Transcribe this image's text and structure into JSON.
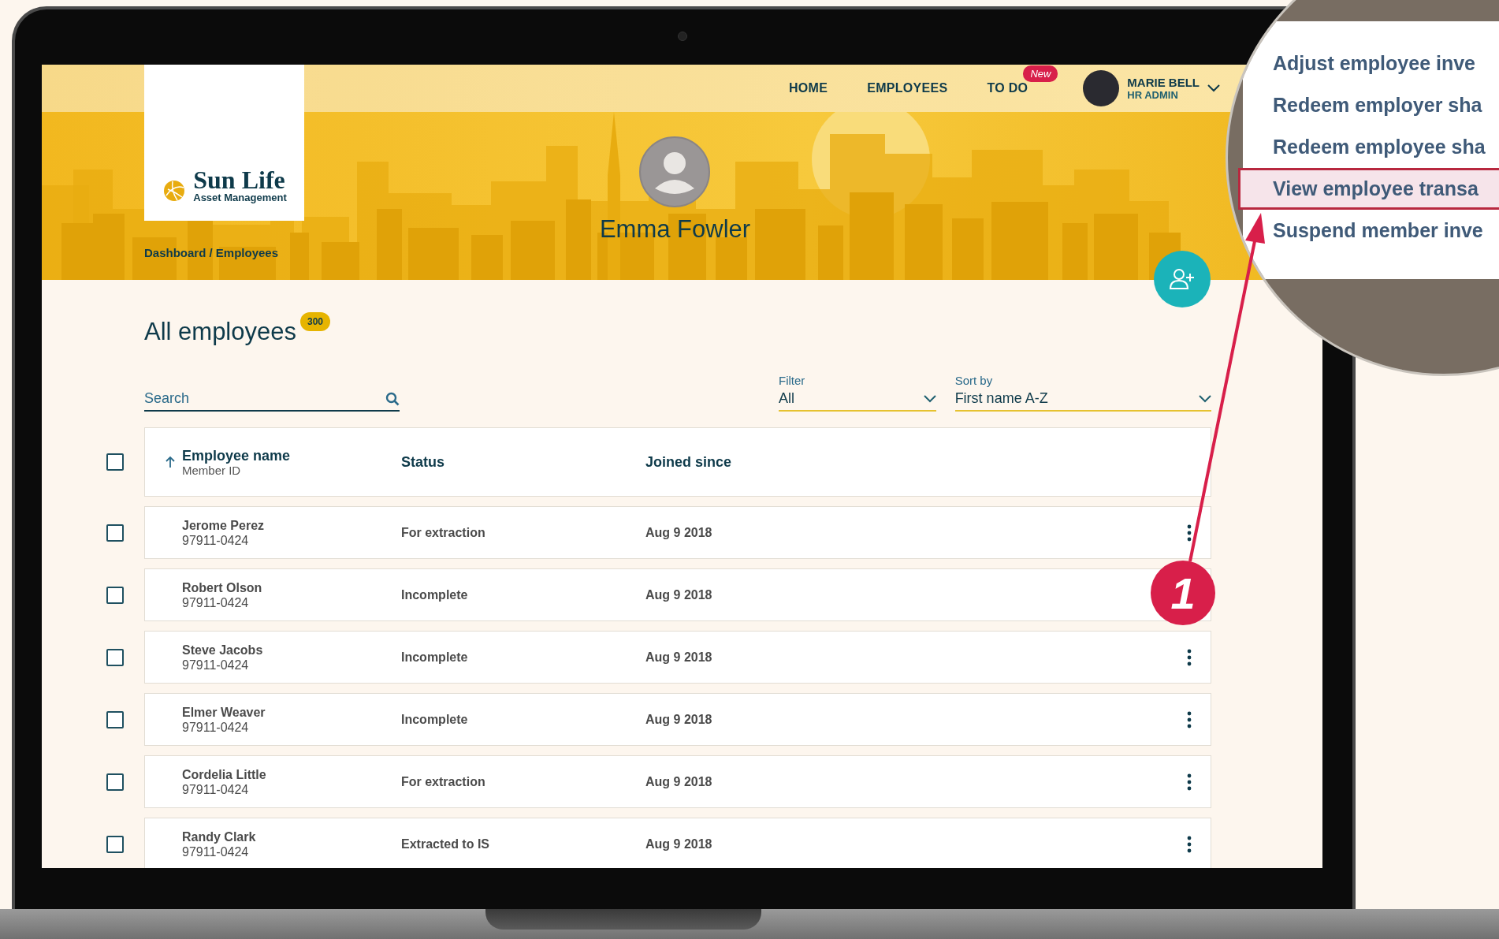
{
  "nav": {
    "logo": {
      "name": "Sun Life",
      "subtitle": "Asset Management"
    },
    "links": [
      {
        "label": "HOME"
      },
      {
        "label": "EMPLOYEES"
      },
      {
        "label": "TO DO",
        "badge": "New"
      }
    ],
    "user": {
      "name": "MARIE BELL",
      "role": "HR ADMIN"
    }
  },
  "profile": {
    "name": "Emma Fowler"
  },
  "breadcrumb": "Dashboard / Employees",
  "page": {
    "title": "All employees",
    "count": "300"
  },
  "search": {
    "placeholder": "Search"
  },
  "filter": {
    "label": "Filter",
    "value": "All"
  },
  "sort": {
    "label": "Sort by",
    "value": "First name A-Z"
  },
  "table": {
    "checked": false,
    "columns": [
      {
        "label": "Employee name",
        "sublabel": "Member ID"
      },
      {
        "label": "Status"
      },
      {
        "label": "Joined since"
      }
    ],
    "rows": [
      {
        "name": "Jerome Perez",
        "member_id": "97911-0424",
        "status": "For extraction",
        "joined": "Aug 9 2018",
        "checked": false
      },
      {
        "name": "Robert Olson",
        "member_id": "97911-0424",
        "status": "Incomplete",
        "joined": "Aug 9 2018",
        "checked": false
      },
      {
        "name": "Steve Jacobs",
        "member_id": "97911-0424",
        "status": "Incomplete",
        "joined": "Aug 9 2018",
        "checked": false
      },
      {
        "name": "Elmer Weaver",
        "member_id": "97911-0424",
        "status": "Incomplete",
        "joined": "Aug 9 2018",
        "checked": false
      },
      {
        "name": "Cordelia Little",
        "member_id": "97911-0424",
        "status": "For extraction",
        "joined": "Aug 9 2018",
        "checked": false
      },
      {
        "name": "Randy Clark",
        "member_id": "97911-0424",
        "status": "Extracted to IS",
        "joined": "Aug 9 2018",
        "checked": false
      }
    ]
  },
  "callout": {
    "number": "1",
    "menu_items": [
      {
        "label": "Adjust employee inve",
        "selected": false
      },
      {
        "label": "Redeem employer sha",
        "selected": false
      },
      {
        "label": "Redeem employee sha",
        "selected": false
      },
      {
        "label": "View employee transa",
        "selected": true
      },
      {
        "label": "Suspend member inve",
        "selected": false
      }
    ]
  }
}
